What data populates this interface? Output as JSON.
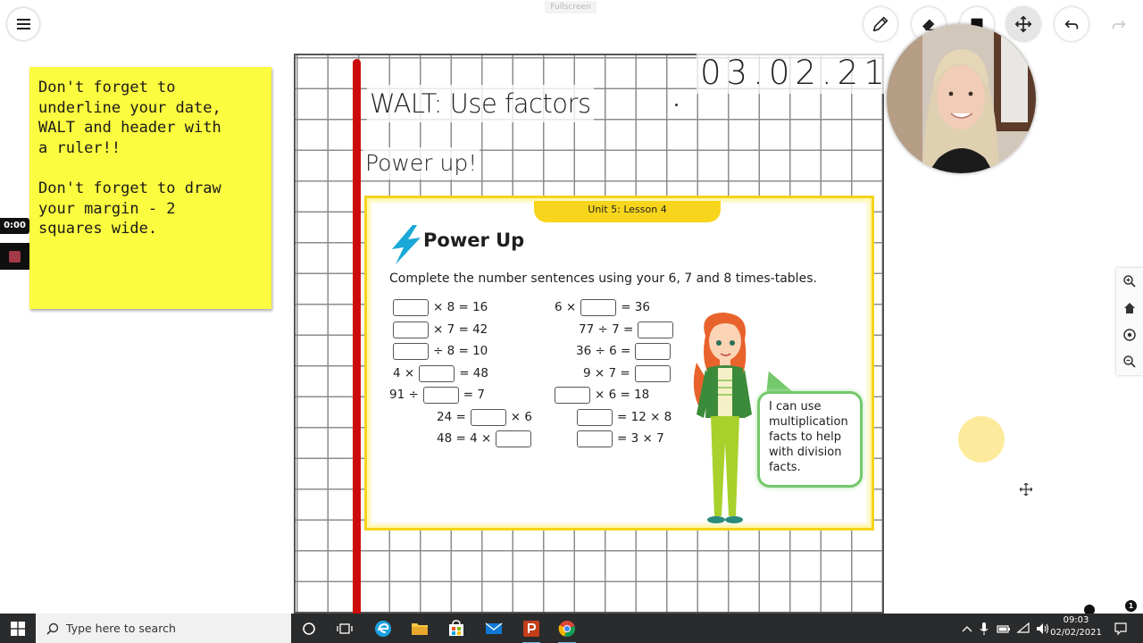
{
  "app": {
    "fullscreen_label": "Fullscreen"
  },
  "toolbar": {
    "tools": [
      "pencil-icon",
      "eraser-icon",
      "color-swatch-icon",
      "move-icon",
      "undo-icon",
      "redo-icon"
    ],
    "active_tool": "move",
    "color_swatch": "#111111"
  },
  "sticky_note": {
    "text": "Don't forget to\nunderline your date,\nWALT and header with\na ruler!!\n\nDon't forget to draw\nyour margin - 2\nsquares wide."
  },
  "recording": {
    "timer": "0:00"
  },
  "board": {
    "date": "03.02.21",
    "walt": "WALT: Use factors",
    "heading": "Power up!"
  },
  "worksheet": {
    "unit_label": "Unit 5: Lesson 4",
    "title": "Power Up",
    "instruction": "Complete the number sentences using your 6, 7 and 8 times-tables.",
    "left_column": [
      {
        "before": "",
        "after": "× 8 = 16"
      },
      {
        "before": "",
        "after": "× 7 = 42"
      },
      {
        "before": "",
        "after": "÷ 8 = 10"
      },
      {
        "before": "4 ×",
        "after": "= 48"
      },
      {
        "before": "91 ÷",
        "after": "= 7"
      },
      {
        "before": "24 =",
        "after": "× 6"
      },
      {
        "before": "48 = 4 ×",
        "after": ""
      }
    ],
    "right_column": [
      {
        "before": "6 ×",
        "after": "= 36"
      },
      {
        "before": "77 ÷ 7 =",
        "after": ""
      },
      {
        "before": "36 ÷ 6 =",
        "after": ""
      },
      {
        "before": "9 × 7 =",
        "after": ""
      },
      {
        "before": "",
        "after": "× 6 = 18"
      },
      {
        "before": "",
        "after": "= 12 × 8"
      },
      {
        "before": "",
        "after": "= 3 × 7"
      }
    ],
    "speech_bubble": "I can use\nmultiplication\nfacts to help\nwith division\nfacts."
  },
  "side_tools": [
    "zoom-in-icon",
    "home-icon",
    "target-icon",
    "zoom-out-icon"
  ],
  "notifications": {
    "badge_count": "1"
  },
  "taskbar": {
    "search_placeholder": "Type here to search",
    "time": "09:03",
    "date": "02/02/2021"
  },
  "colors": {
    "sticky": "#fbfb3f",
    "margin": "#cc0c0c",
    "worksheet_border": "#f5d31b",
    "speech_border": "#74c86c",
    "bolt": "#1aa8d6"
  }
}
